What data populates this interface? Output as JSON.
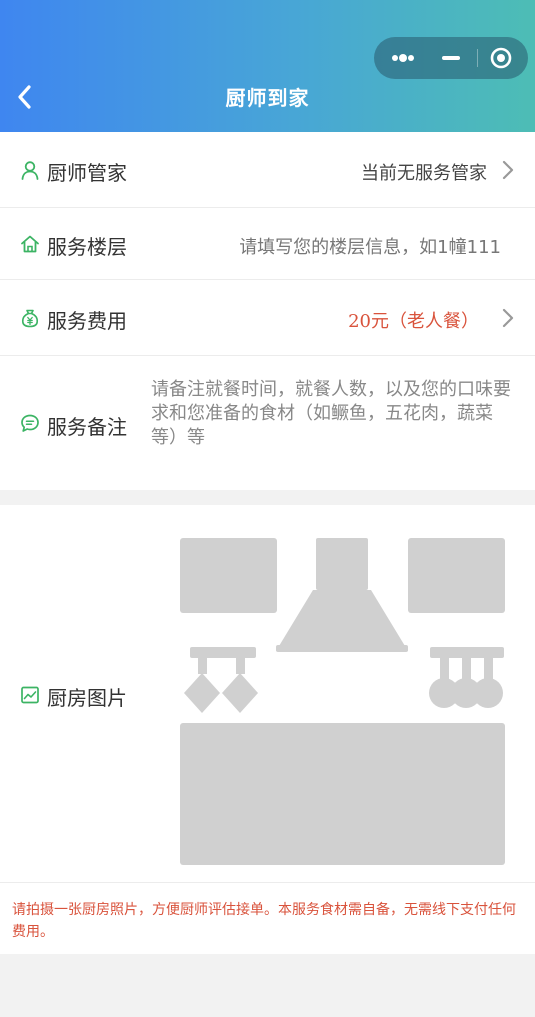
{
  "header": {
    "title": "厨师到家",
    "gradient": [
      "#3f86f0",
      "#4dbdb5"
    ],
    "back_icon": "chevron-left-icon",
    "capsule_icons": [
      "more-dots-icon",
      "minimize-icon",
      "close-target-icon"
    ]
  },
  "form": {
    "manager": {
      "label": "厨师管家",
      "value": "当前无服务管家",
      "icon": "user-icon"
    },
    "floor": {
      "label": "服务楼层",
      "placeholder": "请填写您的楼层信息，如1幢111",
      "icon": "home-icon"
    },
    "fee": {
      "label": "服务费用",
      "value": "20元（老人餐）",
      "icon": "money-bag-icon",
      "value_color": "#d9533c"
    },
    "notes": {
      "label": "服务备注",
      "placeholder": "请备注就餐时间，就餐人数，以及您的口味要求和您准备的食材（如鳜鱼，五花肉，蔬菜等）等",
      "icon": "chat-bubble-icon"
    },
    "kitchen": {
      "label": "厨房图片",
      "icon": "image-icon",
      "placeholder_icon": "kitchen-placeholder-icon"
    }
  },
  "tip": {
    "text": "请拍摄一张厨房照片，方便厨师评估接单。本服务食材需自备，无需线下支付任何费用。",
    "color": "#d9533c"
  },
  "colors": {
    "accent_green": "#3cb464",
    "placeholder_gray": "#d0d0d0"
  }
}
